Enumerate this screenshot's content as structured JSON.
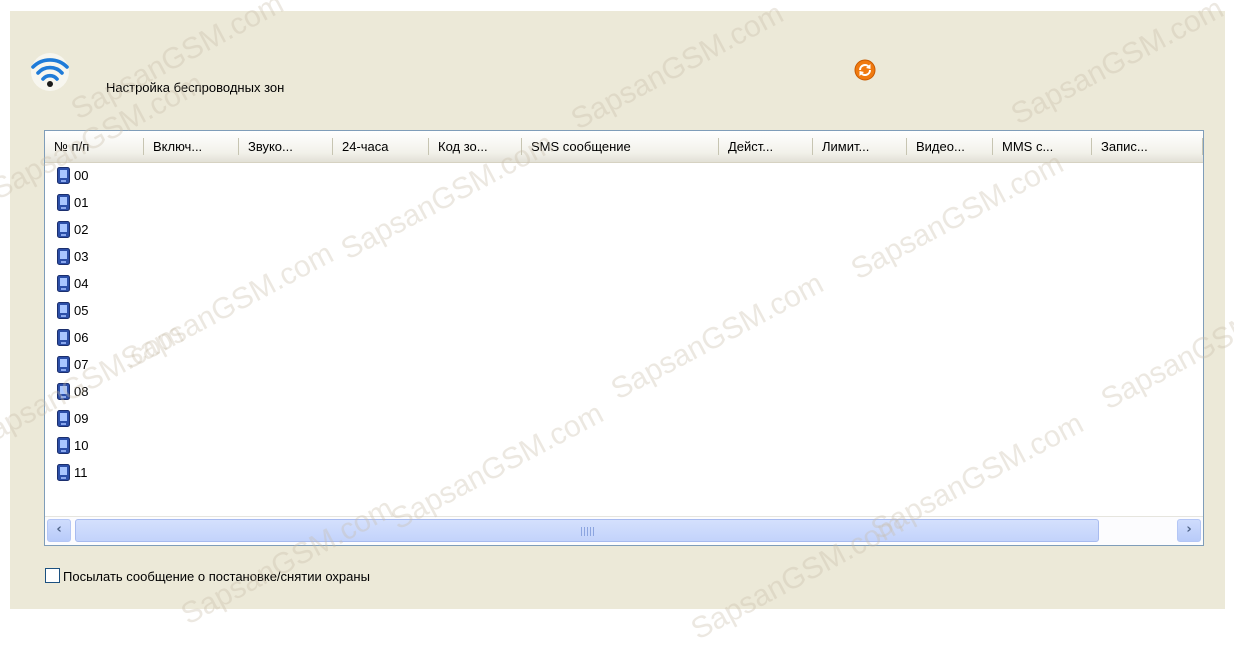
{
  "header": {
    "title": "Настройка беспроводных зон"
  },
  "table": {
    "columns": [
      "№ п/п",
      "Включ...",
      "Звуко...",
      "24-часа",
      "Код зо...",
      "SMS сообщение",
      "Дейст...",
      "Лимит...",
      "Видео...",
      "MMS с...",
      "Запис..."
    ],
    "rows": [
      "00",
      "01",
      "02",
      "03",
      "04",
      "05",
      "06",
      "07",
      "08",
      "09",
      "10",
      "11"
    ]
  },
  "options": {
    "send_message_label": "Посылать сообщение о постановке/снятии охраны",
    "send_message_checked": false
  },
  "watermark": "SapsanGSM.com",
  "icons": {
    "header": "wireless-icon",
    "refresh": "refresh-icon",
    "row": "zone-device-icon",
    "scroll_left": "arrow-left-icon",
    "scroll_right": "arrow-right-icon"
  },
  "colors": {
    "panel_background": "#ece9d8",
    "wifi_blue": "#1f7bd8",
    "refresh_orange": "#f07a10",
    "scrollbar_blue": "#c3d3fb"
  }
}
